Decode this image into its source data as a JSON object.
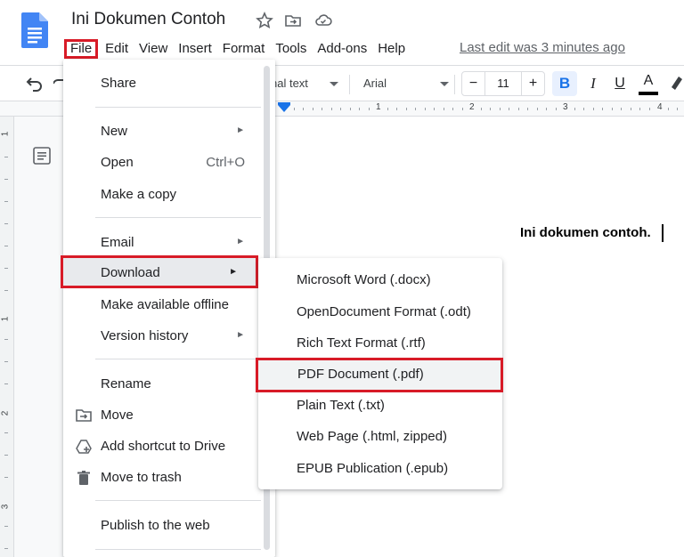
{
  "app": {
    "doc_title": "Ini Dokumen Contoh",
    "last_edit": "Last edit was 3 minutes ago",
    "menubar": [
      "File",
      "Edit",
      "View",
      "Insert",
      "Format",
      "Tools",
      "Add-ons",
      "Help"
    ]
  },
  "toolbar": {
    "style_text": "nal text",
    "font_name": "Arial",
    "font_size": "11",
    "minus": "−",
    "plus": "+",
    "bold": "B",
    "italic": "I",
    "underline": "U",
    "text_color": "A"
  },
  "ruler": {
    "marks": [
      "1",
      "2",
      "3",
      "4"
    ]
  },
  "vruler": {
    "marks": [
      "1",
      "1",
      "2",
      "3"
    ]
  },
  "document": {
    "body_text": "Ini dokumen contoh."
  },
  "file_menu": {
    "items": [
      {
        "label": "Share"
      },
      {
        "label": "New",
        "arrow": "►"
      },
      {
        "label": "Open",
        "shortcut": "Ctrl+O"
      },
      {
        "label": "Make a copy"
      },
      {
        "label": "Email",
        "arrow": "►"
      },
      {
        "label": "Download",
        "arrow": "►"
      },
      {
        "label": "Make available offline"
      },
      {
        "label": "Version history",
        "arrow": "►"
      },
      {
        "label": "Rename"
      },
      {
        "label": "Move"
      },
      {
        "label": "Add shortcut to Drive"
      },
      {
        "label": "Move to trash"
      },
      {
        "label": "Publish to the web"
      }
    ]
  },
  "download_menu": {
    "items": [
      {
        "label": "Microsoft Word (.docx)"
      },
      {
        "label": "OpenDocument Format (.odt)"
      },
      {
        "label": "Rich Text Format (.rtf)"
      },
      {
        "label": "PDF Document (.pdf)"
      },
      {
        "label": "Plain Text (.txt)"
      },
      {
        "label": "Web Page (.html, zipped)"
      },
      {
        "label": "EPUB Publication (.epub)"
      }
    ]
  },
  "colors": {
    "highlight_box": "#d81b27",
    "accent": "#1a73e8",
    "docs_blue": "#4285f4"
  }
}
